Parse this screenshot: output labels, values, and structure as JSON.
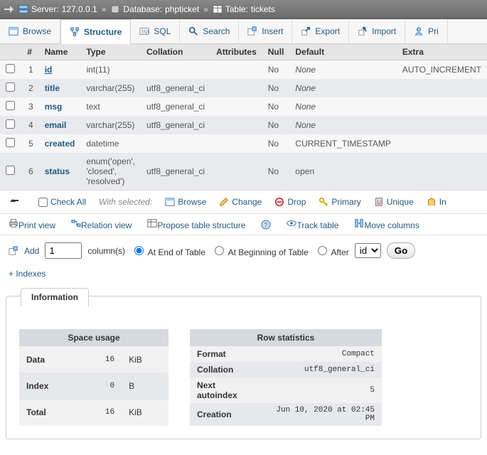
{
  "breadcrumb": {
    "server_label": "Server:",
    "server": "127.0.0.1",
    "db_label": "Database:",
    "db": "phpticket",
    "table_label": "Table:",
    "table": "tickets"
  },
  "tabs": {
    "browse": "Browse",
    "structure": "Structure",
    "sql": "SQL",
    "search": "Search",
    "insert": "Insert",
    "export": "Export",
    "import": "Import",
    "privileges": "Pri"
  },
  "headers": {
    "num": "#",
    "name": "Name",
    "type": "Type",
    "collation": "Collation",
    "attributes": "Attributes",
    "null": "Null",
    "default": "Default",
    "extra": "Extra"
  },
  "rows": [
    {
      "num": "1",
      "name": "id",
      "type": "int(11)",
      "collation": "",
      "null": "No",
      "default": "None",
      "extra": "AUTO_INCREMENT",
      "pk": true
    },
    {
      "num": "2",
      "name": "title",
      "type": "varchar(255)",
      "collation": "utf8_general_ci",
      "null": "No",
      "default": "None",
      "extra": ""
    },
    {
      "num": "3",
      "name": "msg",
      "type": "text",
      "collation": "utf8_general_ci",
      "null": "No",
      "default": "None",
      "extra": ""
    },
    {
      "num": "4",
      "name": "email",
      "type": "varchar(255)",
      "collation": "utf8_general_ci",
      "null": "No",
      "default": "None",
      "extra": ""
    },
    {
      "num": "5",
      "name": "created",
      "type": "datetime",
      "collation": "",
      "null": "No",
      "default": "CURRENT_TIMESTAMP",
      "extra": ""
    },
    {
      "num": "6",
      "name": "status",
      "type": "enum('open', 'closed', 'resolved')",
      "collation": "utf8_general_ci",
      "null": "No",
      "default": "open",
      "extra": ""
    }
  ],
  "batch": {
    "check_all": "Check All",
    "with_selected": "With selected:",
    "browse": "Browse",
    "change": "Change",
    "drop": "Drop",
    "primary": "Primary",
    "unique": "Unique",
    "index": "In"
  },
  "ops": {
    "print": "Print view",
    "relation": "Relation view",
    "propose": "Propose table structure",
    "track": "Track table",
    "move": "Move columns"
  },
  "add": {
    "add": "Add",
    "value": "1",
    "columns": "column(s)",
    "at_end": "At End of Table",
    "at_begin": "At Beginning of Table",
    "after": "After",
    "after_col": "id",
    "go": "Go"
  },
  "indexes": "+ Indexes",
  "info": {
    "title": "Information",
    "space": {
      "title": "Space usage",
      "rows": [
        [
          "Data",
          "16",
          "KiB"
        ],
        [
          "Index",
          "0",
          "B"
        ],
        [
          "Total",
          "16",
          "KiB"
        ]
      ]
    },
    "stats": {
      "title": "Row statistics",
      "rows": [
        [
          "Format",
          "Compact"
        ],
        [
          "Collation",
          "utf8_general_ci"
        ],
        [
          "Next autoindex",
          "5"
        ],
        [
          "Creation",
          "Jun 10, 2020 at 02:45 PM"
        ]
      ]
    }
  }
}
